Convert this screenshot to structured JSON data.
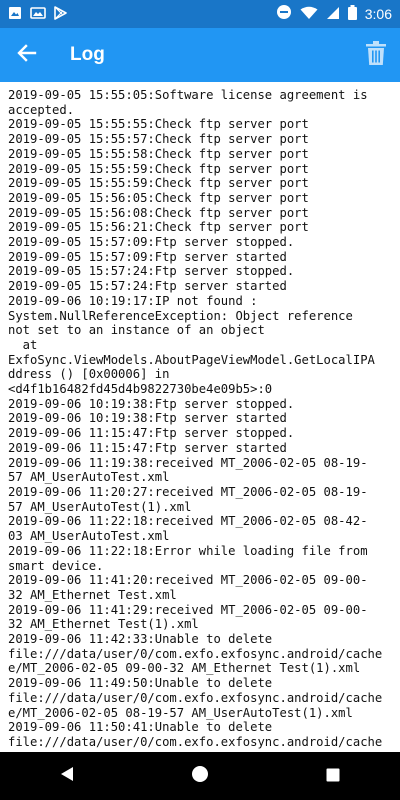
{
  "status_bar": {
    "time": "3:06",
    "icons": [
      "image-icon",
      "photo-icon",
      "play-store-icon",
      "do-not-disturb-icon",
      "wifi-icon",
      "signal-icon",
      "battery-icon"
    ]
  },
  "app_bar": {
    "title": "Log",
    "back_icon": "arrow-back-icon",
    "delete_icon": "trash-icon",
    "color": "#2196f3",
    "status_color": "#1976c8"
  },
  "log": {
    "lines": [
      "2019-09-05 15:55:05:Software license agreement is",
      "accepted.",
      "2019-09-05 15:55:55:Check ftp server port",
      "2019-09-05 15:55:57:Check ftp server port",
      "2019-09-05 15:55:58:Check ftp server port",
      "2019-09-05 15:55:59:Check ftp server port",
      "2019-09-05 15:55:59:Check ftp server port",
      "2019-09-05 15:56:05:Check ftp server port",
      "2019-09-05 15:56:08:Check ftp server port",
      "2019-09-05 15:56:21:Check ftp server port",
      "2019-09-05 15:57:09:Ftp server stopped.",
      "2019-09-05 15:57:09:Ftp server started",
      "2019-09-05 15:57:24:Ftp server stopped.",
      "2019-09-05 15:57:24:Ftp server started",
      "2019-09-06 10:19:17:IP not found :",
      "System.NullReferenceException: Object reference",
      "not set to an instance of an object",
      "  at",
      "ExfoSync.ViewModels.AboutPageViewModel.GetLocalIPA",
      "ddress () [0x00006] in",
      "<d4f1b16482fd45d4b9822730be4e09b5>:0",
      "2019-09-06 10:19:38:Ftp server stopped.",
      "2019-09-06 10:19:38:Ftp server started",
      "2019-09-06 11:15:47:Ftp server stopped.",
      "2019-09-06 11:15:47:Ftp server started",
      "2019-09-06 11:19:38:received MT_2006-02-05 08-19-",
      "57 AM_UserAutoTest.xml",
      "2019-09-06 11:20:27:received MT_2006-02-05 08-19-",
      "57 AM_UserAutoTest(1).xml",
      "2019-09-06 11:22:18:received MT_2006-02-05 08-42-",
      "03 AM_UserAutoTest.xml",
      "2019-09-06 11:22:18:Error while loading file from",
      "smart device.",
      "2019-09-06 11:41:20:received MT_2006-02-05 09-00-",
      "32 AM_Ethernet Test.xml",
      "2019-09-06 11:41:29:received MT_2006-02-05 09-00-",
      "32 AM_Ethernet Test(1).xml",
      "2019-09-06 11:42:33:Unable to delete",
      "file:///data/user/0/com.exfo.exfosync.android/cache",
      "e/MT_2006-02-05 09-00-32 AM_Ethernet Test(1).xml",
      "2019-09-06 11:49:50:Unable to delete",
      "file:///data/user/0/com.exfo.exfosync.android/cache",
      "e/MT_2006-02-05 08-19-57 AM_UserAutoTest(1).xml",
      "2019-09-06 11:50:41:Unable to delete",
      "file:///data/user/0/com.exfo.exfosync.android/cache"
    ]
  },
  "nav_bar": {
    "back_icon": "nav-back-icon",
    "home_icon": "nav-home-icon",
    "recents_icon": "nav-recents-icon"
  }
}
